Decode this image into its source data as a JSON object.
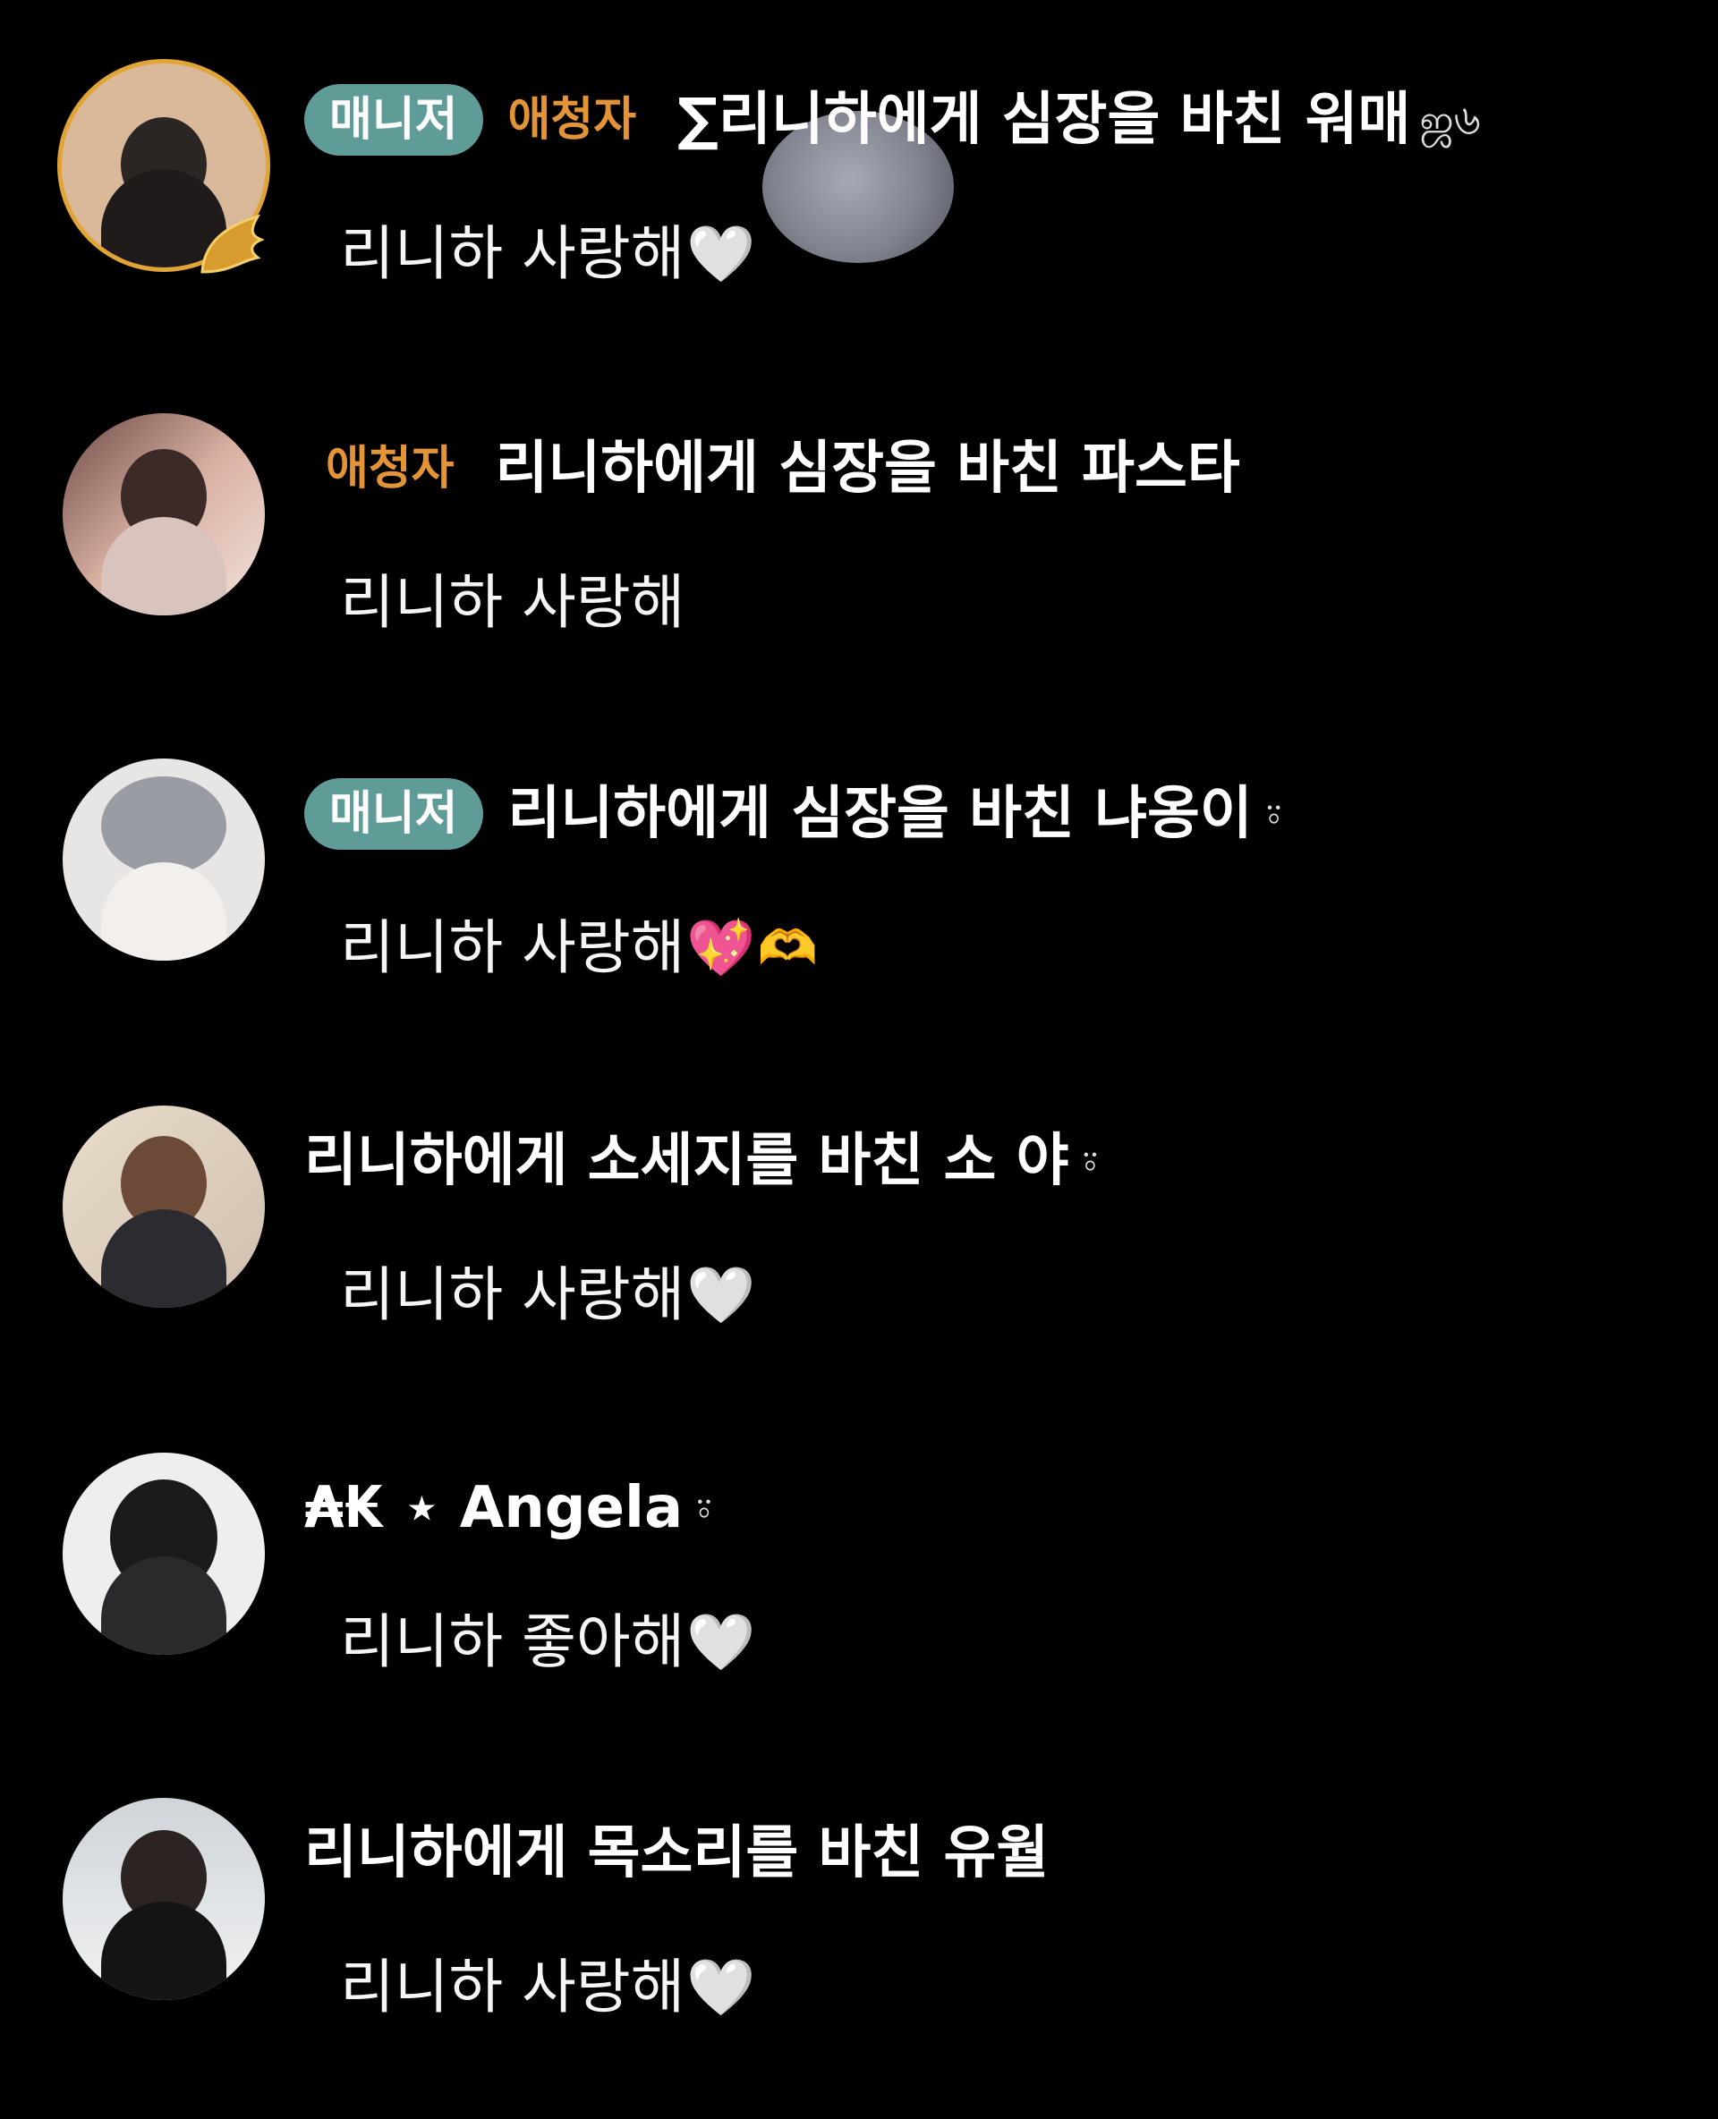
{
  "badges": {
    "manager": "매니저",
    "fan": "애청자"
  },
  "icons": {
    "wing": "golden-wing-icon",
    "ring": "ring-deco-icon",
    "heart_white": "white-heart-emoji",
    "heart_sparkle": "sparkling-heart-emoji",
    "heart_hands": "heart-hands-emoji"
  },
  "colors": {
    "background": "#000000",
    "manager_badge": "#5f9c98",
    "fan_badge": "#e39437",
    "avatar_ring": "#e0a437"
  },
  "messages": [
    {
      "badge_manager": "매니저",
      "badge_fan": "애청자",
      "name": "∑리니하에게 심장을 바친 워매",
      "name_deco": "ஜ৬",
      "text": "리니하 사랑해",
      "emoji": "🤍"
    },
    {
      "badge_fan": "애청자",
      "name": "리니하에게 심장을 바친 파스타",
      "text": "리니하 사랑해"
    },
    {
      "badge_manager": "매니저",
      "name": "리니하에게 심장을 바친 냐옹이",
      "name_deco": "⍤",
      "text": "리니하 사랑해",
      "emoji": "💖",
      "emoji2": "🫶"
    },
    {
      "name": "리니하에게 소세지를 바친 소 야",
      "name_deco": "⍤",
      "text": "리니하 사랑해",
      "emoji": "🤍"
    },
    {
      "name": "₳₭ ⋆ Angela",
      "name_deco": "⍤",
      "text": "리니하 좋아해",
      "emoji": "🤍"
    },
    {
      "name": "리니하에게 목소리를 바친 유월",
      "text": "리니하 사랑해",
      "emoji": "🤍"
    }
  ]
}
